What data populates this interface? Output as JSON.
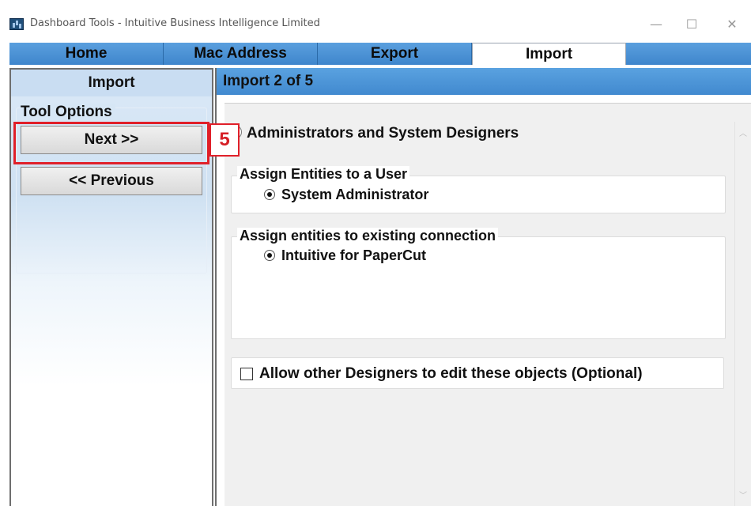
{
  "window": {
    "title": "Dashboard Tools - Intuitive Business Intelligence Limited",
    "minimize": "—",
    "maximize": "☐",
    "close": "✕"
  },
  "tabs": [
    {
      "label": "Home",
      "active": false
    },
    {
      "label": "Mac Address",
      "active": false
    },
    {
      "label": "Export",
      "active": false
    },
    {
      "label": "Import",
      "active": true
    }
  ],
  "left_panel": {
    "header": "Import",
    "tool_options_label": "Tool Options",
    "next_button": "Next >>",
    "previous_button": "<< Previous"
  },
  "callout": {
    "number": "5",
    "color": "#e0202a"
  },
  "right_panel": {
    "header": "Import 2 of 5",
    "main_option": "Administrators and System Designers",
    "assign_user_group": {
      "title": "Assign Entities to a User",
      "selected": "System Administrator"
    },
    "assign_connection_group": {
      "title": "Assign entities to existing connection",
      "selected": "Intuitive for PaperCut"
    },
    "allow_edit_checkbox": {
      "label": "Allow other Designers to edit these objects (Optional)",
      "checked": false
    }
  },
  "colors": {
    "tab_blue": "#4a92d6",
    "highlight_red": "#e0202a"
  }
}
